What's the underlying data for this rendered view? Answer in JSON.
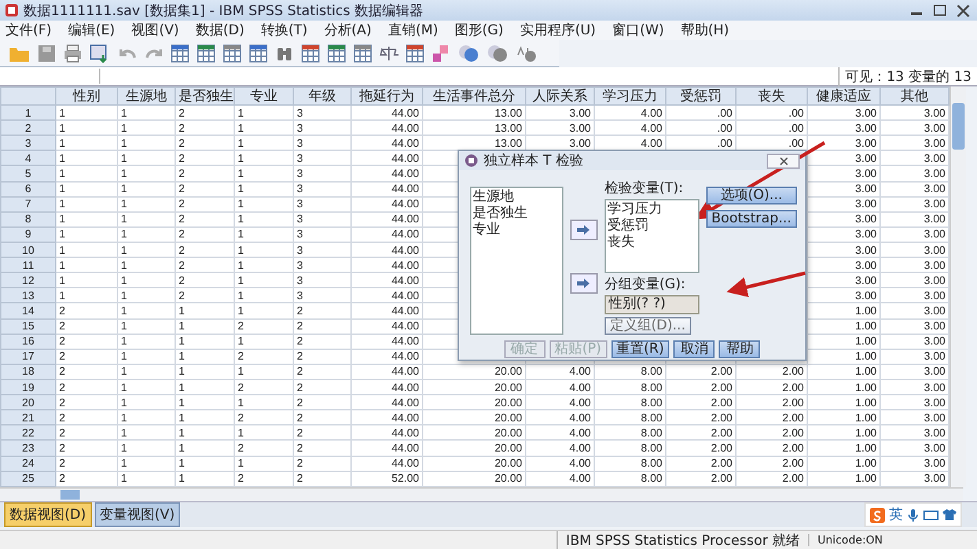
{
  "window": {
    "title": "数据1111111.sav [数据集1] - IBM SPSS Statistics 数据编辑器"
  },
  "menu": [
    "文件(F)",
    "编辑(E)",
    "视图(V)",
    "数据(D)",
    "转换(T)",
    "分析(A)",
    "直销(M)",
    "图形(G)",
    "实用程序(U)",
    "窗口(W)",
    "帮助(H)"
  ],
  "cell_editor": {
    "visible_count": "可见：13 变量的 13"
  },
  "table": {
    "columns": [
      {
        "label": "性别",
        "kind": "nominal"
      },
      {
        "label": "生源地",
        "kind": "nominal"
      },
      {
        "label": "是否独生",
        "kind": "nominal"
      },
      {
        "label": "专业",
        "kind": "nominal"
      },
      {
        "label": "年级",
        "kind": "nominal"
      },
      {
        "label": "拖延行为",
        "kind": "scale"
      },
      {
        "label": "生活事件总分",
        "kind": "scale"
      },
      {
        "label": "人际关系",
        "kind": "scale"
      },
      {
        "label": "学习压力",
        "kind": "scale"
      },
      {
        "label": "受惩罚",
        "kind": "scale"
      },
      {
        "label": "丧失",
        "kind": "scale"
      },
      {
        "label": "健康适应",
        "kind": "scale"
      },
      {
        "label": "其他",
        "kind": "scale"
      }
    ],
    "rows": [
      {
        "num": "1",
        "cells": [
          "1",
          "1",
          "2",
          "1",
          "3",
          "44.00",
          "13.00",
          "3.00",
          "4.00",
          ".00",
          ".00",
          "3.00",
          "3.00"
        ]
      },
      {
        "num": "2",
        "cells": [
          "1",
          "1",
          "2",
          "1",
          "3",
          "44.00",
          "13.00",
          "3.00",
          "4.00",
          ".00",
          ".00",
          "3.00",
          "3.00"
        ]
      },
      {
        "num": "3",
        "cells": [
          "1",
          "1",
          "2",
          "1",
          "3",
          "44.00",
          "13.00",
          "3.00",
          "4.00",
          ".00",
          ".00",
          "3.00",
          "3.00"
        ]
      },
      {
        "num": "4",
        "cells": [
          "1",
          "1",
          "2",
          "1",
          "3",
          "44.00",
          null,
          null,
          null,
          null,
          null,
          "3.00",
          "3.00"
        ]
      },
      {
        "num": "5",
        "cells": [
          "1",
          "1",
          "2",
          "1",
          "3",
          "44.00",
          null,
          null,
          null,
          null,
          null,
          "3.00",
          "3.00"
        ]
      },
      {
        "num": "6",
        "cells": [
          "1",
          "1",
          "2",
          "1",
          "3",
          "44.00",
          null,
          null,
          null,
          null,
          null,
          "3.00",
          "3.00"
        ]
      },
      {
        "num": "7",
        "cells": [
          "1",
          "1",
          "2",
          "1",
          "3",
          "44.00",
          null,
          null,
          null,
          null,
          null,
          "3.00",
          "3.00"
        ]
      },
      {
        "num": "8",
        "cells": [
          "1",
          "1",
          "2",
          "1",
          "3",
          "44.00",
          null,
          null,
          null,
          null,
          null,
          "3.00",
          "3.00"
        ]
      },
      {
        "num": "9",
        "cells": [
          "1",
          "1",
          "2",
          "1",
          "3",
          "44.00",
          null,
          null,
          null,
          null,
          null,
          "3.00",
          "3.00"
        ]
      },
      {
        "num": "10",
        "cells": [
          "1",
          "1",
          "2",
          "1",
          "3",
          "44.00",
          null,
          null,
          null,
          null,
          null,
          "3.00",
          "3.00"
        ]
      },
      {
        "num": "11",
        "cells": [
          "1",
          "1",
          "2",
          "1",
          "3",
          "44.00",
          null,
          null,
          null,
          null,
          null,
          "3.00",
          "3.00"
        ]
      },
      {
        "num": "12",
        "cells": [
          "1",
          "1",
          "2",
          "1",
          "3",
          "44.00",
          null,
          null,
          null,
          null,
          null,
          "3.00",
          "3.00"
        ]
      },
      {
        "num": "13",
        "cells": [
          "1",
          "1",
          "2",
          "1",
          "3",
          "44.00",
          null,
          null,
          null,
          null,
          null,
          "3.00",
          "3.00"
        ]
      },
      {
        "num": "14",
        "cells": [
          "2",
          "1",
          "1",
          "1",
          "2",
          "44.00",
          null,
          null,
          null,
          null,
          null,
          "1.00",
          "3.00"
        ]
      },
      {
        "num": "15",
        "cells": [
          "2",
          "1",
          "1",
          "2",
          "2",
          "44.00",
          null,
          null,
          null,
          null,
          null,
          "1.00",
          "3.00"
        ]
      },
      {
        "num": "16",
        "cells": [
          "2",
          "1",
          "1",
          "1",
          "2",
          "44.00",
          null,
          null,
          null,
          null,
          null,
          "1.00",
          "3.00"
        ]
      },
      {
        "num": "17",
        "cells": [
          "2",
          "1",
          "1",
          "2",
          "2",
          "44.00",
          null,
          null,
          null,
          null,
          null,
          "1.00",
          "3.00"
        ]
      },
      {
        "num": "18",
        "cells": [
          "2",
          "1",
          "1",
          "1",
          "2",
          "44.00",
          "20.00",
          "4.00",
          "8.00",
          "2.00",
          "2.00",
          "1.00",
          "3.00"
        ]
      },
      {
        "num": "19",
        "cells": [
          "2",
          "1",
          "1",
          "2",
          "2",
          "44.00",
          "20.00",
          "4.00",
          "8.00",
          "2.00",
          "2.00",
          "1.00",
          "3.00"
        ]
      },
      {
        "num": "20",
        "cells": [
          "2",
          "1",
          "1",
          "1",
          "2",
          "44.00",
          "20.00",
          "4.00",
          "8.00",
          "2.00",
          "2.00",
          "1.00",
          "3.00"
        ]
      },
      {
        "num": "21",
        "cells": [
          "2",
          "1",
          "1",
          "2",
          "2",
          "44.00",
          "20.00",
          "4.00",
          "8.00",
          "2.00",
          "2.00",
          "1.00",
          "3.00"
        ]
      },
      {
        "num": "22",
        "cells": [
          "2",
          "1",
          "1",
          "1",
          "2",
          "44.00",
          "20.00",
          "4.00",
          "8.00",
          "2.00",
          "2.00",
          "1.00",
          "3.00"
        ]
      },
      {
        "num": "23",
        "cells": [
          "2",
          "1",
          "1",
          "2",
          "2",
          "44.00",
          "20.00",
          "4.00",
          "8.00",
          "2.00",
          "2.00",
          "1.00",
          "3.00"
        ]
      },
      {
        "num": "24",
        "cells": [
          "2",
          "1",
          "1",
          "1",
          "2",
          "44.00",
          "20.00",
          "4.00",
          "8.00",
          "2.00",
          "2.00",
          "1.00",
          "3.00"
        ]
      },
      {
        "num": "25",
        "cells": [
          "2",
          "1",
          "1",
          "2",
          "2",
          "52.00",
          "20.00",
          "4.00",
          "8.00",
          "2.00",
          "2.00",
          "1.00",
          "3.00"
        ]
      }
    ]
  },
  "dialog": {
    "title": "独立样本 T 检验",
    "source_variables": [
      "生源地",
      "是否独生",
      "专业"
    ],
    "test_label": "检验变量(T):",
    "test_variables": [
      "学习压力",
      "受惩罚",
      "丧失"
    ],
    "group_label": "分组变量(G):",
    "group_value": "性别(? ?)",
    "define_groups": "定义组(D)...",
    "side_buttons": [
      "选项(O)...",
      "Bootstrap..."
    ],
    "buttons": [
      {
        "label": "确定",
        "disabled": true
      },
      {
        "label": "粘贴(P)",
        "disabled": true
      },
      {
        "label": "重置(R)",
        "disabled": false
      },
      {
        "label": "取消",
        "disabled": false
      },
      {
        "label": "帮助",
        "disabled": false
      }
    ]
  },
  "view_tabs": [
    {
      "label": "数据视图(D)",
      "selected": true
    },
    {
      "label": "变量视图(V)",
      "selected": false
    }
  ],
  "ime_bar": {
    "mode": "英"
  },
  "status_bar": [
    "IBM SPSS Statistics Processor 就绪",
    "Unicode:ON"
  ]
}
